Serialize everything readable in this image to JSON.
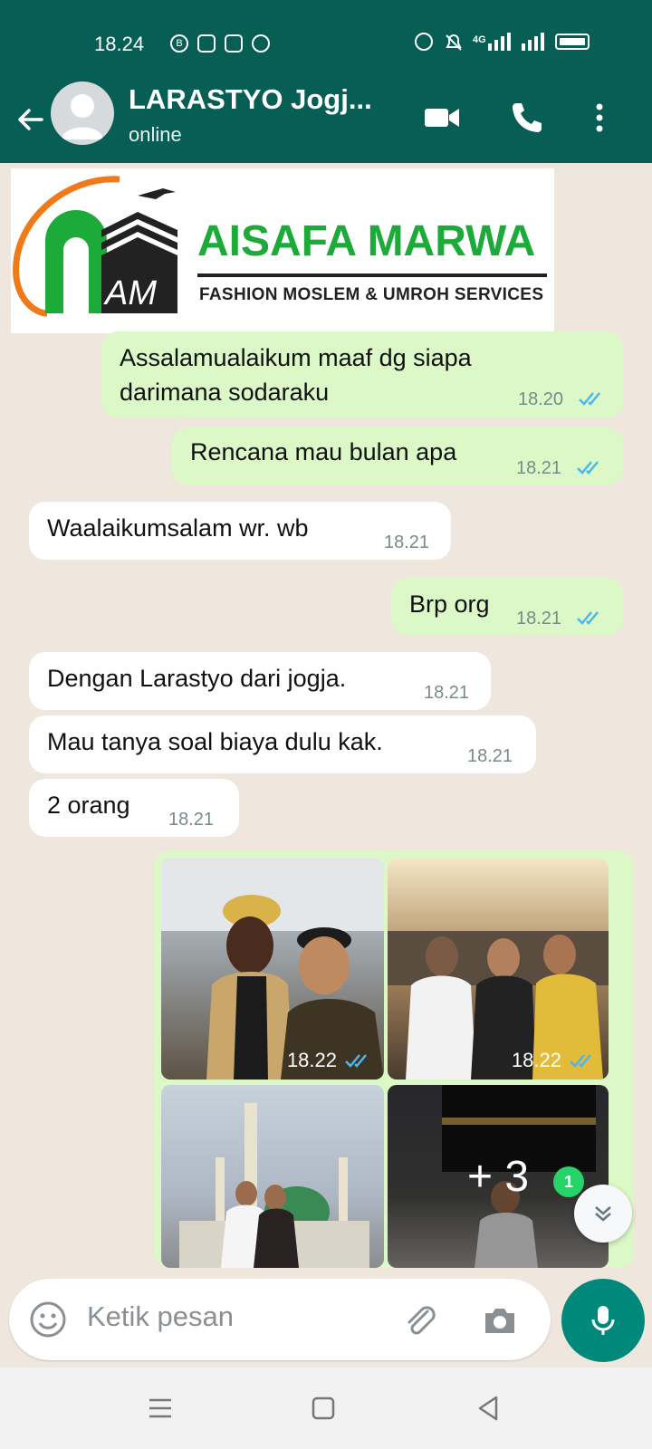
{
  "status_bar": {
    "time": "18.24",
    "left_icons": [
      "b-circle-icon",
      "gallery-icon",
      "store-icon",
      "chrome-icon"
    ],
    "right_icons": [
      "alarm-icon",
      "mute-icon",
      "signal-4g-icon",
      "signal-bars-icon",
      "battery-icon"
    ],
    "network_label": "4G"
  },
  "header": {
    "contact_name": "LARASTYO Jogj...",
    "contact_status": "online",
    "icons": [
      "back-arrow-icon",
      "avatar",
      "video-call-icon",
      "phone-icon",
      "more-vertical-icon"
    ]
  },
  "shared_image": {
    "brand_title": "AISAFA MARWA",
    "brand_subtitle": "FASHION MOSLEM & UMROH SERVICES",
    "monogram": "AM"
  },
  "messages": [
    {
      "direction": "out",
      "text_line1": "Assalamualaikum maaf dg siapa",
      "text_line2": "darimana sodaraku",
      "time": "18.20",
      "read": true
    },
    {
      "direction": "out",
      "text": "Rencana mau bulan apa",
      "time": "18.21",
      "read": true
    },
    {
      "direction": "in",
      "text": "Waalaikumsalam wr. wb",
      "time": "18.21"
    },
    {
      "direction": "out",
      "text": "Brp org",
      "time": "18.21",
      "read": true
    },
    {
      "direction": "in",
      "text": "Dengan Larastyo dari jogja.",
      "time": "18.21"
    },
    {
      "direction": "in",
      "text": "Mau tanya soal biaya dulu kak.",
      "time": "18.21"
    },
    {
      "direction": "in",
      "text": "2 orang",
      "time": "18.21"
    }
  ],
  "media_grid": {
    "tiles": [
      {
        "time": "18.22",
        "read": true
      },
      {
        "time": "18.22",
        "read": true
      },
      {
        "time": ""
      },
      {
        "overlay": "+ 3"
      }
    ]
  },
  "scroll_indicator": {
    "unread_count": "1"
  },
  "composer": {
    "placeholder": "Ketik pesan",
    "icons": [
      "emoji-icon",
      "attachment-icon",
      "camera-icon",
      "microphone-icon"
    ]
  },
  "nav_bar": {
    "icons": [
      "menu-icon",
      "home-square-icon",
      "back-triangle-icon"
    ]
  },
  "colors": {
    "header": "#075e54",
    "outgoing_bubble": "#dcf8c6",
    "incoming_bubble": "#ffffff",
    "chat_bg": "#efe7de",
    "read_ticks": "#4fb6ec",
    "mic_button": "#00897b",
    "brand_green": "#1cab38",
    "brand_orange": "#f07a1a"
  }
}
